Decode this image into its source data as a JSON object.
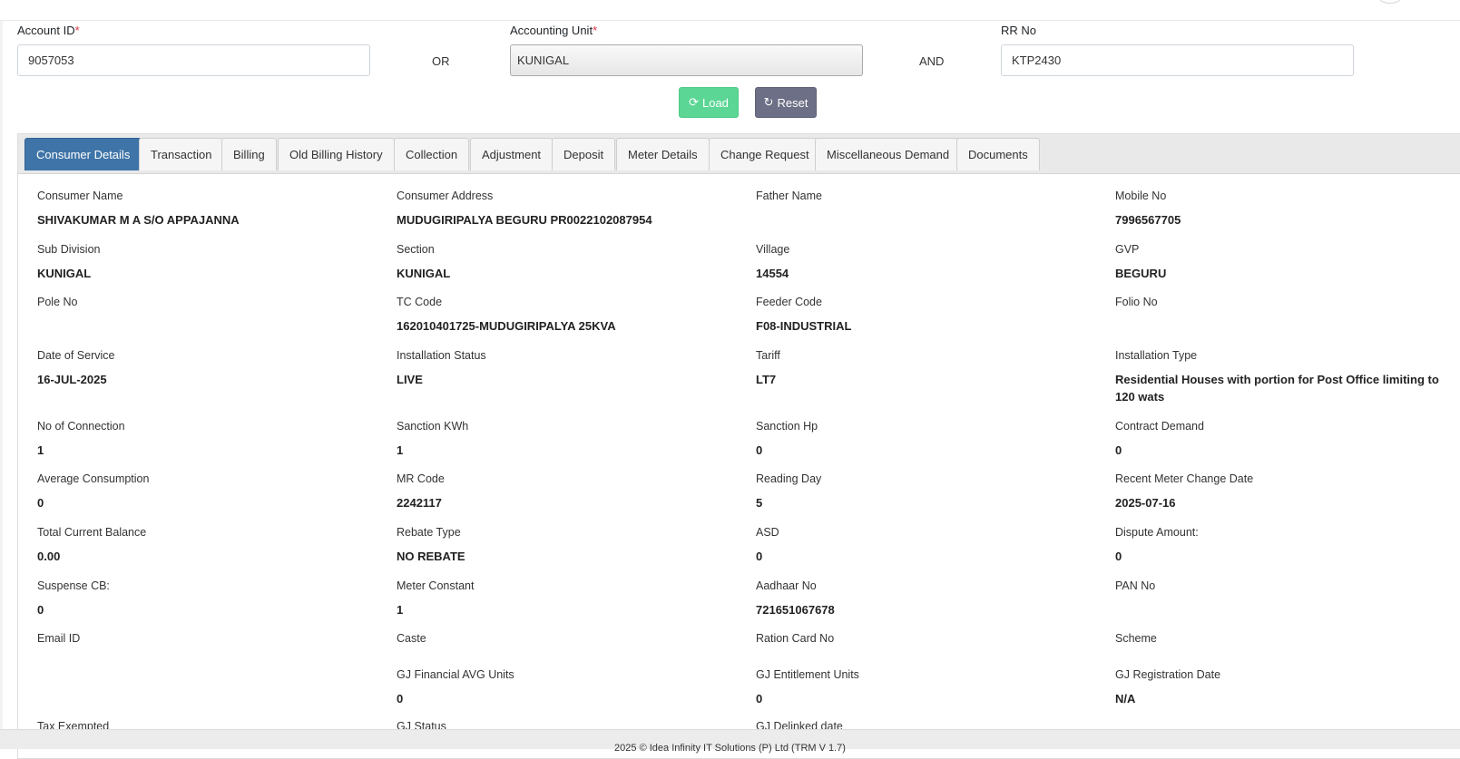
{
  "search": {
    "account_id": {
      "label": "Account ID",
      "required": "*",
      "value": "9057053"
    },
    "or_label": "OR",
    "accounting_unit": {
      "label": "Accounting Unit",
      "required": "*",
      "value": "KUNIGAL"
    },
    "and_label": "AND",
    "rr_no": {
      "label": "RR No",
      "value": "KTP2430"
    },
    "load_label": "Load",
    "reset_label": "Reset"
  },
  "tabs": [
    {
      "label": "Consumer Details",
      "active": true
    },
    {
      "label": "Transaction"
    },
    {
      "label": "Billing"
    },
    {
      "label": "Old Billing History"
    },
    {
      "label": "Collection"
    },
    {
      "label": "Adjustment"
    },
    {
      "label": "Deposit"
    },
    {
      "label": "Meter Details"
    },
    {
      "label": "Change Request"
    },
    {
      "label": "Miscellaneous Demand"
    },
    {
      "label": "Documents"
    }
  ],
  "details": [
    {
      "label": "Consumer Name",
      "value": "SHIVAKUMAR M A S/O APPAJANNA"
    },
    {
      "label": "Consumer Address",
      "value": "MUDUGIRIPALYA BEGURU PR0022102087954"
    },
    {
      "label": "Father Name",
      "value": ""
    },
    {
      "label": "Mobile No",
      "value": "7996567705"
    },
    {
      "label": "Sub Division",
      "value": "KUNIGAL"
    },
    {
      "label": "Section",
      "value": "KUNIGAL"
    },
    {
      "label": "Village",
      "value": "14554"
    },
    {
      "label": "GVP",
      "value": "BEGURU"
    },
    {
      "label": "Pole No",
      "value": ""
    },
    {
      "label": "TC Code",
      "value": "162010401725-MUDUGIRIPALYA 25KVA"
    },
    {
      "label": "Feeder Code",
      "value": "F08-INDUSTRIAL"
    },
    {
      "label": "Folio No",
      "value": ""
    },
    {
      "label": "Date of Service",
      "value": "16-JUL-2025"
    },
    {
      "label": "Installation Status",
      "value": "LIVE"
    },
    {
      "label": "Tariff",
      "value": "LT7"
    },
    {
      "label": "Installation Type",
      "value": "Residential Houses with portion for Post Office limiting to 120 wats"
    },
    {
      "label": "No of Connection",
      "value": "1"
    },
    {
      "label": "Sanction KWh",
      "value": "1"
    },
    {
      "label": "Sanction Hp",
      "value": "0"
    },
    {
      "label": "Contract Demand",
      "value": "0"
    },
    {
      "label": "Average Consumption",
      "value": "0"
    },
    {
      "label": "MR Code",
      "value": "2242117"
    },
    {
      "label": "Reading Day",
      "value": "5"
    },
    {
      "label": "Recent Meter Change Date",
      "value": "2025-07-16"
    },
    {
      "label": "Total Current Balance",
      "value": "0.00"
    },
    {
      "label": "Rebate Type",
      "value": "NO REBATE"
    },
    {
      "label": "ASD",
      "value": "0"
    },
    {
      "label": "Dispute Amount:",
      "value": "0"
    },
    {
      "label": "Suspense CB:",
      "value": "0"
    },
    {
      "label": "Meter Constant",
      "value": "1"
    },
    {
      "label": "Aadhaar No",
      "value": "721651067678"
    },
    {
      "label": "PAN No",
      "value": ""
    },
    {
      "label": "Email ID",
      "value": ""
    },
    {
      "label": "Caste",
      "value": ""
    },
    {
      "label": "Ration Card No",
      "value": ""
    },
    {
      "label": "Scheme",
      "value": ""
    },
    {
      "label": "",
      "value": ""
    },
    {
      "label": "GJ Financial AVG Units",
      "value": "0"
    },
    {
      "label": "GJ Entitlement Units",
      "value": "0"
    },
    {
      "label": "GJ Registration Date",
      "value": "N/A"
    },
    {
      "label": "Tax Exempted",
      "value": ""
    },
    {
      "label": "GJ Status",
      "value": ""
    },
    {
      "label": "GJ Delinked date",
      "value": ""
    },
    {
      "label": "",
      "value": ""
    }
  ],
  "footer": {
    "text": "2025 © Idea Infinity IT Solutions (P) Ltd (TRM V 1.7)"
  },
  "colors": {
    "active_tab": "#3f74a8",
    "load_button": "#5cd694",
    "reset_button": "#6c6f85",
    "required_mark": "#dc3545"
  }
}
